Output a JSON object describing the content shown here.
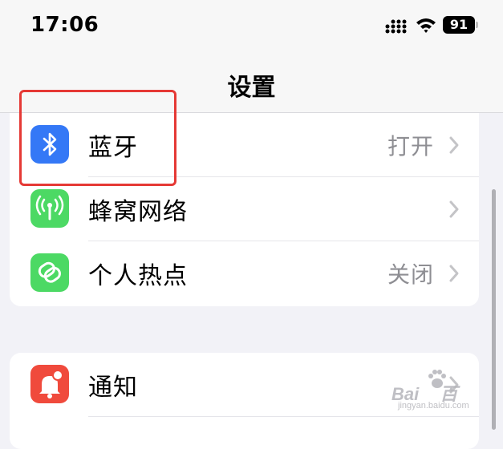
{
  "status_bar": {
    "time": "17:06",
    "battery_level": "91"
  },
  "nav": {
    "title": "设置"
  },
  "group1": [
    {
      "label": "蓝牙",
      "value": "打开",
      "icon": "bluetooth-icon",
      "color": "#3478f6"
    },
    {
      "label": "蜂窝网络",
      "value": "",
      "icon": "cellular-antenna-icon",
      "color": "#4cd964"
    },
    {
      "label": "个人热点",
      "value": "关闭",
      "icon": "hotspot-link-icon",
      "color": "#4cd964"
    }
  ],
  "group2": [
    {
      "label": "通知",
      "value": "",
      "icon": "notification-bell-icon",
      "color": "#ff3b30"
    }
  ],
  "watermark": {
    "brand": "Bai",
    "brand_tail": "百",
    "domain": "jingyan.baidu.com"
  }
}
